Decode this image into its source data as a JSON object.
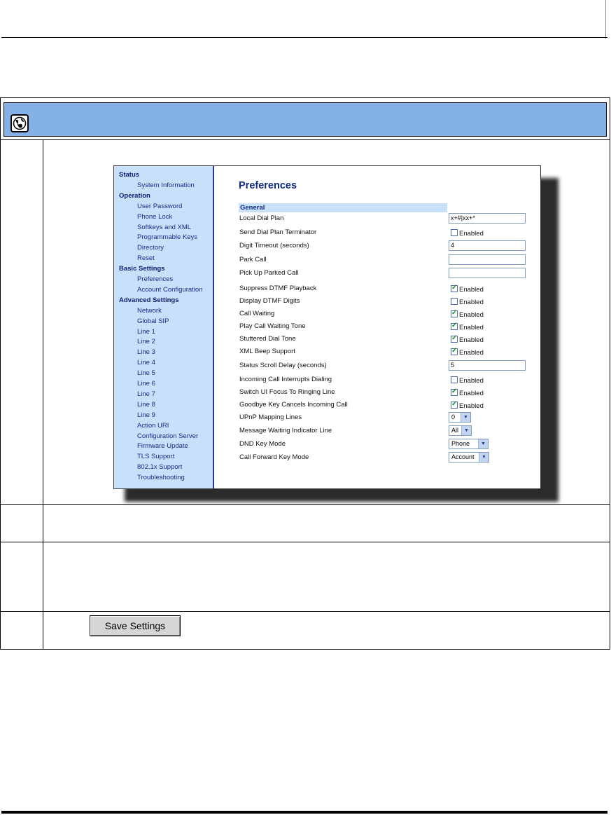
{
  "save_button": "Save Settings",
  "screenshot": {
    "nav": [
      {
        "type": "section",
        "label": "Status"
      },
      {
        "type": "item",
        "label": "System Information"
      },
      {
        "type": "section",
        "label": "Operation"
      },
      {
        "type": "item",
        "label": "User Password"
      },
      {
        "type": "item",
        "label": "Phone Lock"
      },
      {
        "type": "item",
        "label": "Softkeys and XML"
      },
      {
        "type": "item",
        "label": "Programmable Keys"
      },
      {
        "type": "item",
        "label": "Directory"
      },
      {
        "type": "item",
        "label": "Reset"
      },
      {
        "type": "section",
        "label": "Basic Settings"
      },
      {
        "type": "item",
        "label": "Preferences"
      },
      {
        "type": "item",
        "label": "Account Configuration"
      },
      {
        "type": "section",
        "label": "Advanced Settings"
      },
      {
        "type": "item",
        "label": "Network"
      },
      {
        "type": "item",
        "label": "Global SIP"
      },
      {
        "type": "item",
        "label": "Line 1"
      },
      {
        "type": "item",
        "label": "Line 2"
      },
      {
        "type": "item",
        "label": "Line 3"
      },
      {
        "type": "item",
        "label": "Line 4"
      },
      {
        "type": "item",
        "label": "Line 5"
      },
      {
        "type": "item",
        "label": "Line 6"
      },
      {
        "type": "item",
        "label": "Line 7"
      },
      {
        "type": "item",
        "label": "Line 8"
      },
      {
        "type": "item",
        "label": "Line 9"
      },
      {
        "type": "item",
        "label": "Action URI"
      },
      {
        "type": "item",
        "label": "Configuration Server"
      },
      {
        "type": "item",
        "label": "Firmware Update"
      },
      {
        "type": "item",
        "label": "TLS Support"
      },
      {
        "type": "item",
        "label": "802.1x Support"
      },
      {
        "type": "item",
        "label": "Troubleshooting"
      }
    ],
    "title": "Preferences",
    "group_header": "General",
    "enabled_label": "Enabled",
    "fields": [
      {
        "label": "Local Dial Plan",
        "control": "text",
        "value": "x+#|xx+*"
      },
      {
        "label": "Send Dial Plan Terminator",
        "control": "checkbox",
        "checked": false
      },
      {
        "label": "Digit Timeout (seconds)",
        "control": "text",
        "value": "4"
      },
      {
        "label": "Park Call",
        "control": "text",
        "value": ""
      },
      {
        "label": "Pick Up Parked Call",
        "control": "text",
        "value": ""
      },
      {
        "label": "Suppress DTMF Playback",
        "control": "checkbox",
        "checked": true
      },
      {
        "label": "Display DTMF Digits",
        "control": "checkbox",
        "checked": false
      },
      {
        "label": "Call Waiting",
        "control": "checkbox",
        "checked": true
      },
      {
        "label": "Play Call Waiting Tone",
        "control": "checkbox",
        "checked": true
      },
      {
        "label": "Stuttered Dial Tone",
        "control": "checkbox",
        "checked": true
      },
      {
        "label": "XML Beep Support",
        "control": "checkbox",
        "checked": true
      },
      {
        "label": "Status Scroll Delay (seconds)",
        "control": "text",
        "value": "5"
      },
      {
        "label": "Incoming Call Interrupts Dialing",
        "control": "checkbox",
        "checked": false
      },
      {
        "label": "Switch UI Focus To Ringing Line",
        "control": "checkbox",
        "checked": true
      },
      {
        "label": "Goodbye Key Cancels Incoming Call",
        "control": "checkbox",
        "checked": true
      },
      {
        "label": "UPnP Mapping Lines",
        "control": "select",
        "value": "0"
      },
      {
        "label": "Message Waiting Indicator Line",
        "control": "select",
        "value": "All"
      },
      {
        "label": "DND Key Mode",
        "control": "select",
        "value": "Phone"
      },
      {
        "label": "Call Forward Key Mode",
        "control": "select",
        "value": "Account"
      }
    ]
  }
}
